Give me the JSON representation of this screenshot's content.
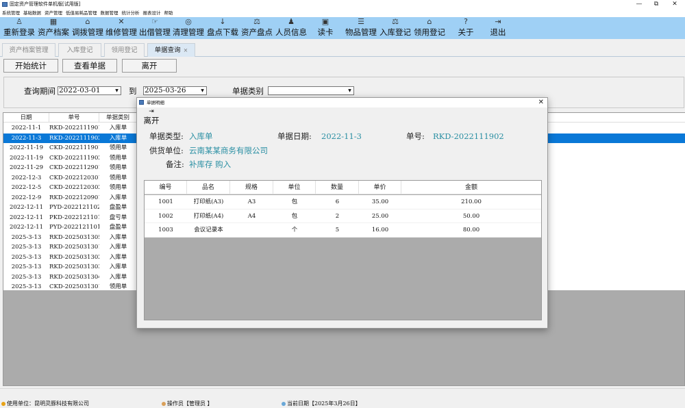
{
  "window": {
    "title": "固定资产管理软件单机版[试用版]",
    "minimize": "—",
    "restore": "⧉",
    "close": "✕"
  },
  "menu": [
    "系统管理",
    "基础数据",
    "资产管理",
    "低值易耗品管理",
    "数据管理",
    "统计分析",
    "报表设计",
    "帮助"
  ],
  "toolbar": [
    {
      "icon": "person-icon",
      "glyph": "♙",
      "label": "重新登录"
    },
    {
      "icon": "grid-icon",
      "glyph": "▦",
      "label": "资产档案"
    },
    {
      "icon": "transfer-icon",
      "glyph": "⌂",
      "label": "调拨管理"
    },
    {
      "icon": "wrench-icon",
      "glyph": "✕",
      "label": "维修管理"
    },
    {
      "icon": "lend-icon",
      "glyph": "☞",
      "label": "出借管理"
    },
    {
      "icon": "clean-icon",
      "glyph": "◎",
      "label": "清理管理"
    },
    {
      "icon": "download-icon",
      "glyph": "↓",
      "label": "盘点下载"
    },
    {
      "icon": "scale-icon",
      "glyph": "⚖",
      "label": "资产盘点"
    },
    {
      "icon": "people-icon",
      "glyph": "♟",
      "label": "人员信息"
    },
    {
      "icon": "card-icon",
      "glyph": "▣",
      "label": "读卡"
    },
    {
      "icon": "database-icon",
      "glyph": "☰",
      "label": "物品管理"
    },
    {
      "icon": "stock-in-icon",
      "glyph": "⚖",
      "label": "入库登记"
    },
    {
      "icon": "receive-icon",
      "glyph": "⌂",
      "label": "领用登记"
    },
    {
      "icon": "help-icon",
      "glyph": "?",
      "label": "关于"
    },
    {
      "icon": "exit-icon",
      "glyph": "⇥",
      "label": "退出"
    }
  ],
  "tabs": [
    {
      "label": "资产档案管理",
      "active": false
    },
    {
      "label": "入库登记",
      "active": false
    },
    {
      "label": "领用登记",
      "active": false
    },
    {
      "label": "单据查询",
      "active": true,
      "close": "×"
    }
  ],
  "actions": {
    "start": "开始统计",
    "view": "查看单据",
    "leave": "离开"
  },
  "query": {
    "period_label": "查询期间",
    "date_from": "2022-03-01",
    "to_label": "到",
    "date_to": "2025-03-26",
    "type_label": "单据类别",
    "type_value": ""
  },
  "main_table": {
    "columns": [
      "日期",
      "单号",
      "单据类别"
    ],
    "rows": [
      {
        "date": "2022-11-1",
        "no": "RKD-2022111901",
        "type": "入库单",
        "selected": false
      },
      {
        "date": "2022-11-3",
        "no": "RKD-2022111902",
        "type": "入库单",
        "selected": true
      },
      {
        "date": "2022-11-19",
        "no": "CKD-2022111901",
        "type": "领用单",
        "selected": false
      },
      {
        "date": "2022-11-19",
        "no": "CKD-2022111902",
        "type": "领用单",
        "selected": false
      },
      {
        "date": "2022-11-29",
        "no": "CKD-2022112901",
        "type": "领用单",
        "selected": false
      },
      {
        "date": "2022-12-3",
        "no": "CKD-2022120301",
        "type": "领用单",
        "selected": false
      },
      {
        "date": "2022-12-5",
        "no": "CKD-2022120302",
        "type": "领用单",
        "selected": false
      },
      {
        "date": "2022-12-9",
        "no": "RKD-2022120901",
        "type": "入库单",
        "selected": false
      },
      {
        "date": "2022-12-11",
        "no": "PYD-2022121102",
        "type": "盘盈单",
        "selected": false
      },
      {
        "date": "2022-12-11",
        "no": "PKD-2022121101",
        "type": "盘亏单",
        "selected": false
      },
      {
        "date": "2022-12-11",
        "no": "PYD-2022121101",
        "type": "盘盈单",
        "selected": false
      },
      {
        "date": "2025-3-13",
        "no": "RKD-2025031305",
        "type": "入库单",
        "selected": false
      },
      {
        "date": "2025-3-13",
        "no": "RKD-2025031301",
        "type": "入库单",
        "selected": false
      },
      {
        "date": "2025-3-13",
        "no": "RKD-2025031302",
        "type": "入库单",
        "selected": false
      },
      {
        "date": "2025-3-13",
        "no": "RKD-2025031303",
        "type": "入库单",
        "selected": false
      },
      {
        "date": "2025-3-13",
        "no": "RKD-2025031304",
        "type": "入库单",
        "selected": false
      },
      {
        "date": "2025-3-13",
        "no": "CKD-2025031301",
        "type": "领用单",
        "selected": false
      }
    ]
  },
  "status": {
    "unit": "使用单位：昆明灵豚科技有限公司",
    "operator": "操作员【管理员 】",
    "date": "当前日期【2025年3月26日】"
  },
  "dialog": {
    "title": "单据明细",
    "close": "✕",
    "leave_label": "离开",
    "type_label": "单据类型:",
    "type_value": "入库单",
    "date_label": "单据日期:",
    "date_value": "2022-11-3",
    "no_label": "单号:",
    "no_value": "RKD-2022111902",
    "supplier_label": "供货单位:",
    "supplier_value": "云南某某商务有限公司",
    "remark_label": "备注:",
    "remark_value": "补库存 购入",
    "columns": [
      "编号",
      "品名",
      "规格",
      "单位",
      "数量",
      "单价",
      "金额"
    ],
    "rows": [
      {
        "code": "1001",
        "name": "打印纸(A3)",
        "spec": "A3",
        "unit": "包",
        "qty": "6",
        "price": "35.00",
        "amount": "210.00"
      },
      {
        "code": "1002",
        "name": "打印纸(A4)",
        "spec": "A4",
        "unit": "包",
        "qty": "2",
        "price": "25.00",
        "amount": "50.00"
      },
      {
        "code": "1003",
        "name": "会议记录本",
        "spec": "",
        "unit": "个",
        "qty": "5",
        "price": "16.00",
        "amount": "80.00"
      }
    ]
  },
  "colors": {
    "toolbar": "#9fd0f5",
    "selected_row": "#0a78d7",
    "value_text": "#2a8fa3"
  }
}
